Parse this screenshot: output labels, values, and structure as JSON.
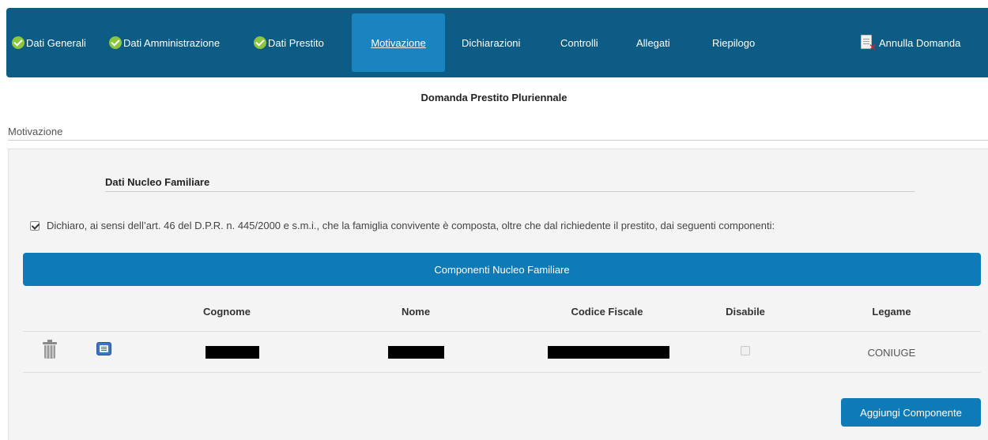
{
  "nav": {
    "items": [
      {
        "label": "Dati Generali",
        "completed": true
      },
      {
        "label": "Dati Amministrazione",
        "completed": true
      },
      {
        "label": "Dati Prestito",
        "completed": true
      },
      {
        "label": "Motivazione",
        "active": true
      },
      {
        "label": "Dichiarazioni"
      },
      {
        "label": "Controlli"
      },
      {
        "label": "Allegati"
      },
      {
        "label": "Riepilogo"
      }
    ],
    "cancel_label": "Annulla Domanda"
  },
  "page_title": "Domanda Prestito Pluriennale",
  "section_label": "Motivazione",
  "fieldset_title": "Dati Nucleo Familiare",
  "declaration": {
    "checked": true,
    "text": "Dichiaro, ai sensi dell’art. 46 del D.P.R. n. 445/2000 e s.m.i., che la famiglia convivente è composta, oltre che dal richiedente il prestito, dai seguenti componenti:"
  },
  "table": {
    "title": "Componenti Nucleo Familiare",
    "columns": [
      "Cognome",
      "Nome",
      "Codice Fiscale",
      "Disabile",
      "Legame"
    ],
    "rows": [
      {
        "cognome": "",
        "nome": "",
        "codice_fiscale": "",
        "disabile": false,
        "legame": "CONIUGE"
      }
    ]
  },
  "add_button_label": "Aggiungi Componente",
  "colors": {
    "nav_bg": "#0c5c85",
    "nav_active": "#1a84c0",
    "primary": "#0f7ab8",
    "check_green": "#8cc63f"
  }
}
